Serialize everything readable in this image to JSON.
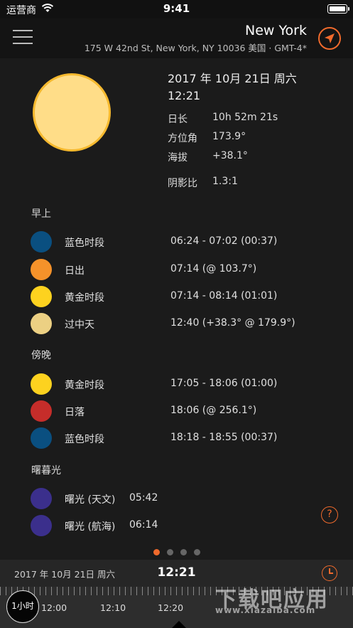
{
  "status_bar": {
    "carrier": "运营商",
    "time": "9:41"
  },
  "header": {
    "city": "New York",
    "address": "175 W 42nd St, New York, NY 10036 美国 · GMT-4*",
    "accent_color": "#f06a2c"
  },
  "sun_info": {
    "date": "2017 年 10月 21日 周六",
    "time": "12:21",
    "rows": [
      {
        "label": "日长",
        "value": "10h 52m 21s"
      },
      {
        "label": "方位角",
        "value": "173.9°"
      },
      {
        "label": "海拔",
        "value": "+38.1°"
      },
      {
        "label": "阴影比",
        "value": "1.3:1"
      }
    ]
  },
  "sections": {
    "morning": {
      "title": "早上",
      "events": [
        {
          "name": "蓝色时段",
          "value": "06:24 - 07:02 (00:37)",
          "color": "#0a4f80"
        },
        {
          "name": "日出",
          "value": "07:14 (@ 103.7°)",
          "color": "#f5922a"
        },
        {
          "name": "黄金时段",
          "value": "07:14 - 08:14 (01:01)",
          "color": "#fdd21f"
        },
        {
          "name": "过中天",
          "value": "12:40 (+38.3° @ 179.9°)",
          "color": "#ecd083"
        }
      ]
    },
    "evening": {
      "title": "傍晚",
      "events": [
        {
          "name": "黄金时段",
          "value": "17:05 - 18:06 (01:00)",
          "color": "#fdd21f"
        },
        {
          "name": "日落",
          "value": "18:06 (@ 256.1°)",
          "color": "#c62d2a"
        },
        {
          "name": "蓝色时段",
          "value": "18:18 - 18:55 (00:37)",
          "color": "#0a4f80"
        }
      ]
    },
    "twilight": {
      "title": "曙暮光",
      "events": [
        {
          "name": "曙光 (天文)",
          "value": "05:42",
          "color": "#3b2f8c"
        },
        {
          "name": "曙光 (航海)",
          "value": "06:14",
          "color": "#3b2f8c"
        }
      ]
    }
  },
  "help": {
    "label": "?"
  },
  "pager": {
    "count": 4,
    "active": 0
  },
  "bottom_bar": {
    "date": "2017 年 10月 21日 周六",
    "time": "12:21",
    "zoom_label": "1小时",
    "tick_labels": [
      "12:00",
      "12:10",
      "12:20"
    ]
  },
  "watermark": {
    "title": "下载吧应用",
    "url": "www.xiazaiba.com"
  }
}
